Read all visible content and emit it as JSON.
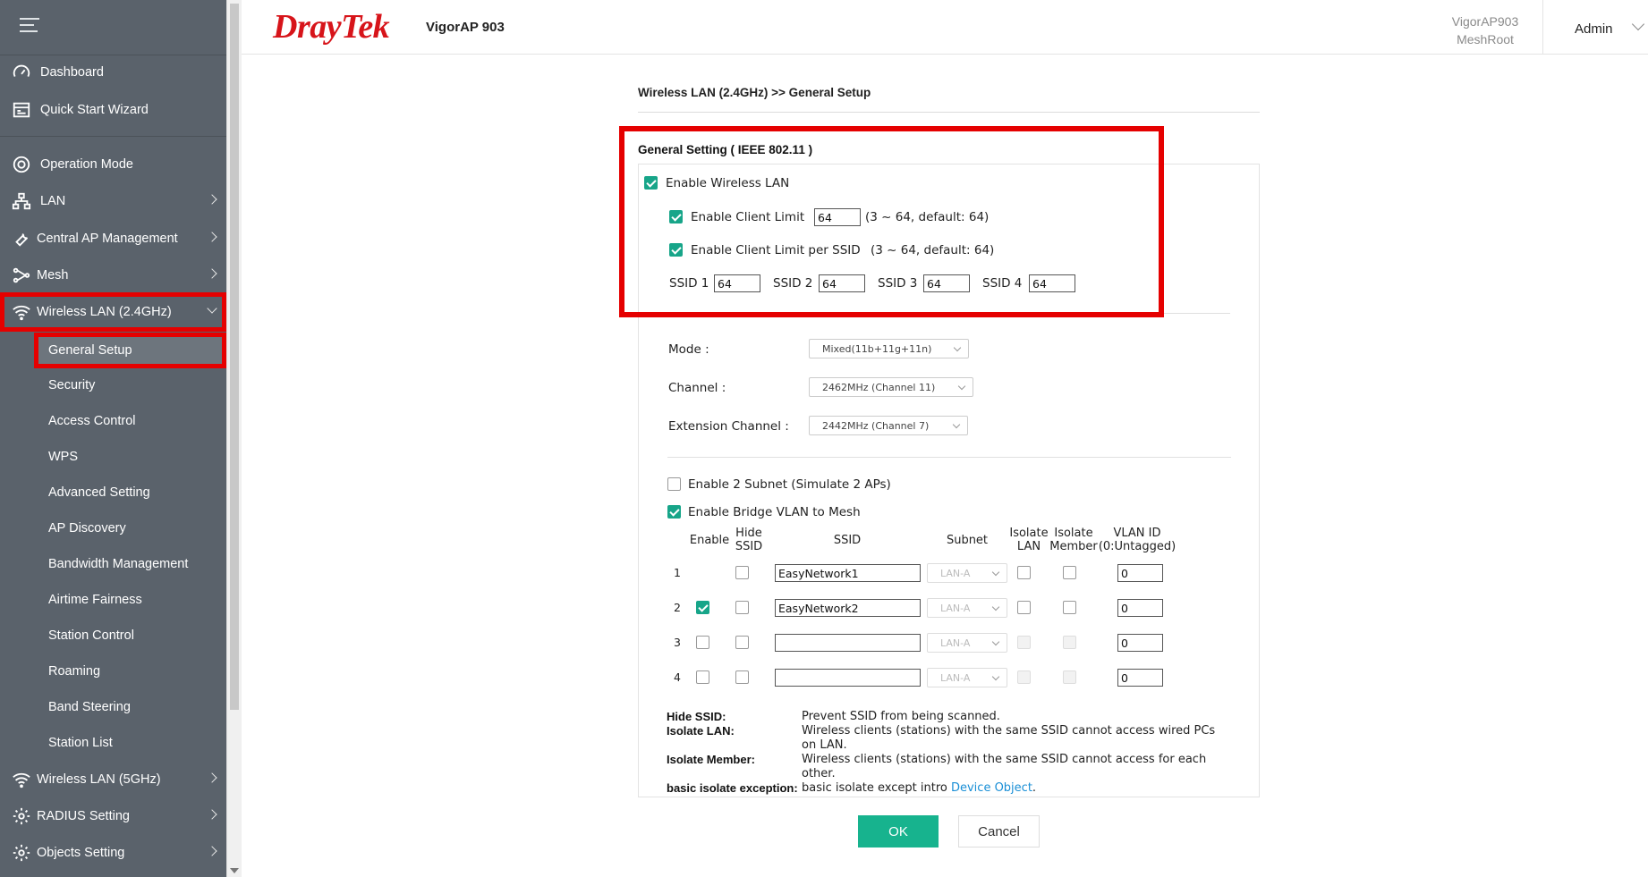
{
  "header": {
    "brand": "DrayTek",
    "model": "VigorAP 903",
    "device_name": "VigorAP903",
    "mesh_role": "MeshRoot",
    "user": "Admin"
  },
  "sidebar": {
    "items": [
      {
        "label": "Dashboard",
        "icon": "dashboard-icon"
      },
      {
        "label": "Quick Start Wizard",
        "icon": "wizard-icon"
      },
      {
        "label": "Operation Mode",
        "icon": "operation-mode-icon"
      },
      {
        "label": "LAN",
        "icon": "lan-icon"
      },
      {
        "label": "Central AP Management",
        "icon": "wrench-icon"
      },
      {
        "label": "Mesh",
        "icon": "mesh-icon"
      },
      {
        "label": "Wireless LAN (2.4GHz)",
        "icon": "wifi-icon"
      },
      {
        "label": "Wireless LAN (5GHz)",
        "icon": "wifi-icon"
      },
      {
        "label": "RADIUS Setting",
        "icon": "gear-icon"
      },
      {
        "label": "Objects Setting",
        "icon": "gear-icon"
      }
    ],
    "sub_items": [
      "General Setup",
      "Security",
      "Access Control",
      "WPS",
      "Advanced Setting",
      "AP Discovery",
      "Bandwidth Management",
      "Airtime Fairness",
      "Station Control",
      "Roaming",
      "Band Steering",
      "Station List"
    ]
  },
  "page": {
    "breadcrumb": "Wireless LAN (2.4GHz) >> General Setup",
    "section_title": "General Setting ( IEEE 802.11 )",
    "enable_wlan": "Enable Wireless LAN",
    "client_limit_label": "Enable Client Limit",
    "client_limit_value": "64",
    "client_limit_hint": "(3 ~ 64, default: 64)",
    "client_limit_ssid_label": "Enable Client Limit per SSID",
    "client_limit_ssid_hint": "(3 ~ 64, default: 64)",
    "ssid_limits": [
      {
        "label": "SSID 1",
        "value": "64"
      },
      {
        "label": "SSID 2",
        "value": "64"
      },
      {
        "label": "SSID 3",
        "value": "64"
      },
      {
        "label": "SSID 4",
        "value": "64"
      }
    ],
    "mode_label": "Mode :",
    "mode_value": "Mixed(11b+11g+11n)",
    "channel_label": "Channel :",
    "channel_value": "2462MHz (Channel 11)",
    "ext_channel_label": "Extension Channel :",
    "ext_channel_value": "2442MHz (Channel 7)",
    "two_subnet_label": "Enable 2 Subnet (Simulate 2 APs)",
    "bridge_vlan_label": "Enable Bridge VLAN to Mesh",
    "table_headers": {
      "enable": "Enable",
      "hide_ssid": "Hide SSID",
      "ssid": "SSID",
      "subnet": "Subnet",
      "isolate_lan": "Isolate LAN",
      "isolate_member": "Isolate Member",
      "vlan_id": "VLAN ID (0:Untagged)"
    },
    "rows": [
      {
        "num": "1",
        "enable": true,
        "ssid": "EasyNetwork1",
        "subnet": "LAN-A",
        "vlan": "0"
      },
      {
        "num": "2",
        "enable": true,
        "ssid": "EasyNetwork2",
        "subnet": "LAN-A",
        "vlan": "0"
      },
      {
        "num": "3",
        "enable": false,
        "ssid": "",
        "subnet": "LAN-A",
        "vlan": "0"
      },
      {
        "num": "4",
        "enable": false,
        "ssid": "",
        "subnet": "LAN-A",
        "vlan": "0"
      }
    ],
    "legend": [
      {
        "key": "Hide SSID:",
        "value": "Prevent SSID from being scanned."
      },
      {
        "key": "Isolate LAN:",
        "value": "Wireless clients (stations) with the same SSID cannot access wired PCs on LAN."
      },
      {
        "key": "Isolate Member:",
        "value": "Wireless clients (stations) with the same SSID cannot access for each other."
      },
      {
        "key": "basic isolate exception:",
        "value": "basic isolate except intro ",
        "link": "Device Object",
        "suffix": "."
      }
    ],
    "ok_label": "OK",
    "cancel_label": "Cancel"
  },
  "colors": {
    "accent": "#17b38e",
    "highlight": "#e50000",
    "sidebar": "#5a626b",
    "brand": "#d7141a"
  }
}
